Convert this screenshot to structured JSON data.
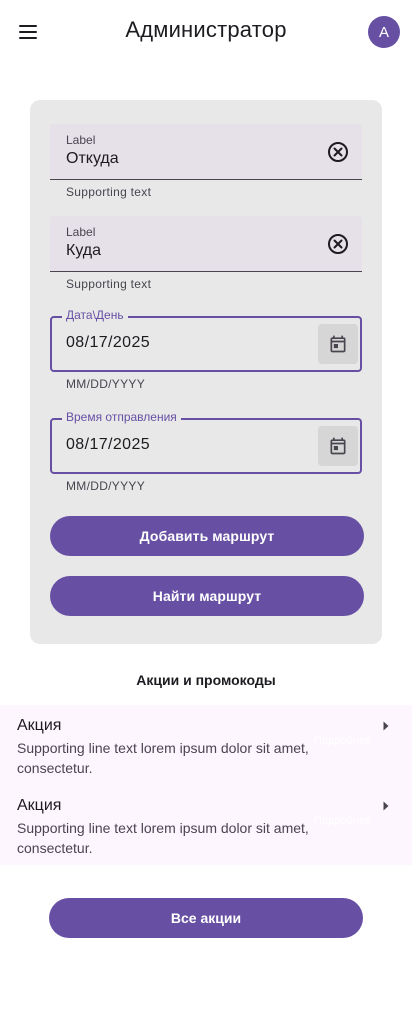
{
  "app_bar": {
    "title": "Администратор",
    "avatar_letter": "A",
    "menu_icon": "menu-icon"
  },
  "form": {
    "from": {
      "label": "Label",
      "value": "Откуда",
      "supporting": "Supporting text",
      "icon": "clear-icon"
    },
    "to": {
      "label": "Label",
      "value": "Куда",
      "supporting": "Supporting text",
      "icon": "clear-icon"
    },
    "date": {
      "label": "Дата\\День",
      "value": "08/17/2025",
      "supporting": "MM/DD/YYYY",
      "icon": "calendar-icon"
    },
    "time": {
      "label": "Время отправления",
      "value": "08/17/2025",
      "supporting": "MM/DD/YYYY",
      "icon": "calendar-icon"
    },
    "add_route_label": "Добавить маршрут",
    "find_route_label": "Найти маршрут"
  },
  "promos": {
    "title": "Акции и промокоды",
    "items": [
      {
        "headline": "Акция",
        "supporting": "Supporting line text lorem ipsum dolor sit amet, consectetur.",
        "trailing": "Подробнее",
        "icon": "arrow-right-icon"
      },
      {
        "headline": "Акция",
        "supporting": "Supporting line text lorem ipsum dolor sit amet, consectetur.",
        "trailing": "Подробнее",
        "icon": "arrow-right-icon"
      }
    ],
    "all_label": "Все акции"
  },
  "colors": {
    "primary": "#6750a4",
    "card_bg": "#e8e8e8",
    "field_bg": "#e6e0e9",
    "list_bg": "#fdf6fe"
  }
}
